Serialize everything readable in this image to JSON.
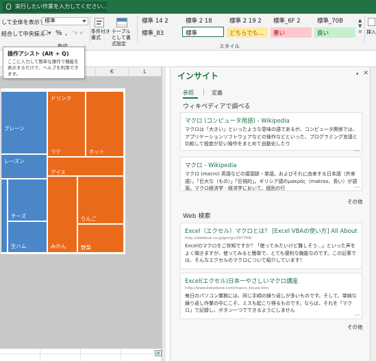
{
  "titlebar": {
    "tell_me": "実行したい作業を入力してください..."
  },
  "ribbon": {
    "alignment": {
      "wrap_text": "して全体を表示する",
      "merge_center": "結合して中央揃え"
    },
    "number": {
      "format_value": "標準",
      "percent": "%",
      "comma": ",",
      "group_label": "数値"
    },
    "styles": {
      "conditional_format": "条件付き書式",
      "format_as_table": "テーブルとして書式設定",
      "cells": [
        {
          "label": "標準 14 2",
          "bg": "#ffffff",
          "color": "#222222"
        },
        {
          "label": "標準 2 18",
          "bg": "#ffffff",
          "color": "#222222"
        },
        {
          "label": "標準 2 19 2",
          "bg": "#ffffff",
          "color": "#222222"
        },
        {
          "label": "標準_6F 2",
          "bg": "#ffffff",
          "color": "#222222"
        },
        {
          "label": "標準_70B",
          "bg": "#ffffff",
          "color": "#222222"
        },
        {
          "label": "標準_83",
          "bg": "#ffffff",
          "color": "#222222"
        },
        {
          "label": "標準",
          "bg": "#ffffff",
          "color": "#222222"
        },
        {
          "label": "どちらでも...",
          "bg": "#ffeb9c",
          "color": "#9c6500"
        },
        {
          "label": "悪い",
          "bg": "#ffc7ce",
          "color": "#9c0006"
        },
        {
          "label": "良い",
          "bg": "#c6efce",
          "color": "#006100"
        }
      ],
      "group_label": "スタイル"
    },
    "insert_label": "挿入"
  },
  "tooltip": {
    "title": "操作アシスト (Alt + Q)",
    "body": "ここに入力して簡単な操作で機能を表示するだけで、ヘルプを利用できます。"
  },
  "sheet": {
    "columns": [
      "K",
      "L"
    ],
    "chart_tiles": [
      "ブレーン",
      "レーズン",
      "チーズ",
      "生ハム",
      "ドリンク",
      "ラテ",
      "ホット",
      "アイス",
      "りんご",
      "みかん",
      "野菜"
    ]
  },
  "insights": {
    "title": "インサイト",
    "tabs": [
      "参照",
      "定義"
    ],
    "wiki_heading": "ウィキペディアで調べる",
    "wiki_results": [
      {
        "title": "マクロ (コンピュータ用語) - Wikipedia",
        "snippet": "マクロは「大きい」といったような意味の語であるが、コンピュータ関係では、アプリケーションソフトウェアなどの操作などといった、プログラミング言語と比較して程度が巨い操作をまとめて自動化したり"
      },
      {
        "title": "マクロ - Wikipedia",
        "snippet": "マクロ (macro) 英語などの接頭辞・単語。およびそれに由来する日本語（外来語）。「巨大な（もの）」「巨視的」。ギリシア語のμακρός（makros、長い）が語源。マクロ経済学 - 経済学において、個別の行"
      }
    ],
    "more_label": "その他",
    "web_heading": "Web 検索",
    "web_results": [
      {
        "title": "Excel（エクセル）マクロとは？ [Excel VBAの使い方] All About",
        "url": "http://allabout.co.jp/gm/gc/297708/",
        "snippet": "Excelのマクロをご存知ですか？「使ってみたいけど難しそう...」といった声をよく聞きますが、使ってみると簡単で、とても便利な機能なのです。この記事では、そんなエクセルのマクロについて紹介しています！"
      },
      {
        "title": "Excel(エクセル)日本一やさしいマクロ講座",
        "url": "http://www.kokodane.com/macro_kouza.htm",
        "snippet": "毎日のパソコン業務には、同じ手順の繰り返しが多いものです。そして、単純な繰り返し作業の中にこそ、ミスも起こり得るものです。ならば、それを「マクロ」で記録し、ボタン一つでできるようにしません"
      }
    ]
  },
  "colors": {
    "excel_green": "#217346",
    "tile_blue": "#4a86c8",
    "tile_orange": "#ea6a1c"
  }
}
